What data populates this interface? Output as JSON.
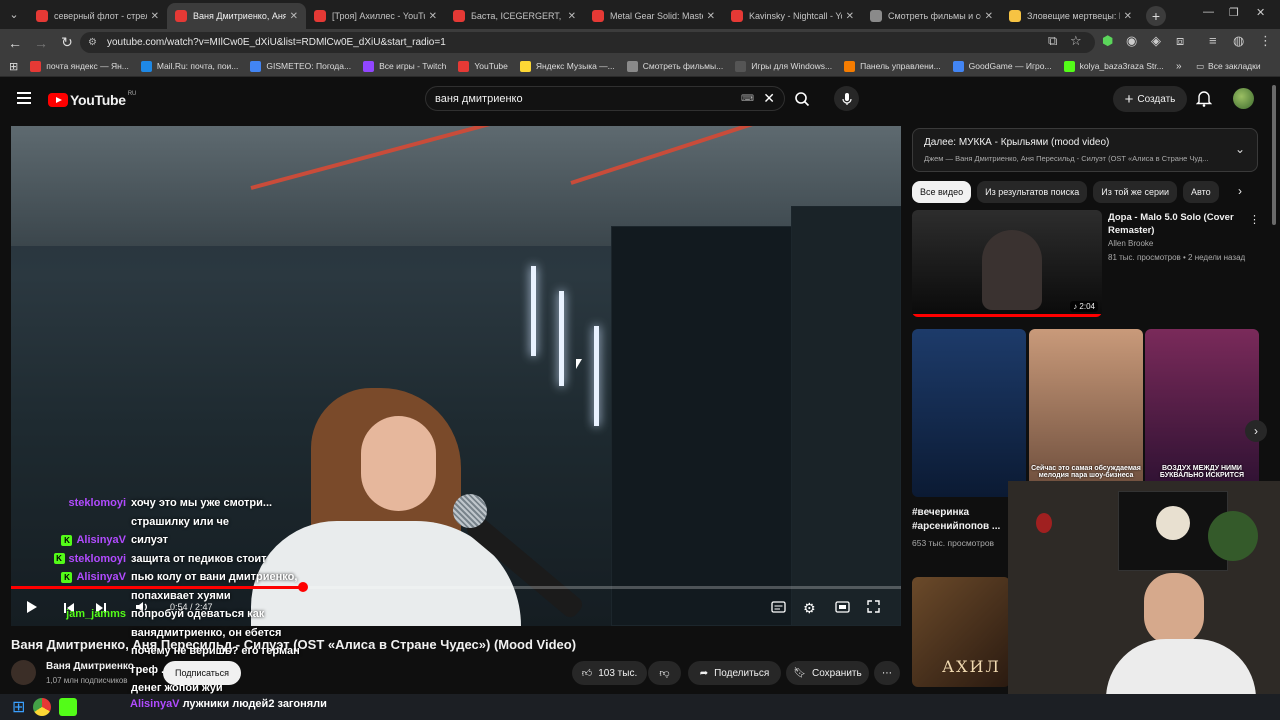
{
  "browser": {
    "tabs": [
      {
        "title": "северный флот - стрельба",
        "color": "#e53935",
        "active": false
      },
      {
        "title": "Ваня Дмитриенко, Аня Пересильд",
        "color": "#e53935",
        "active": true
      },
      {
        "title": "[Троя] Ахиллес - YouTube",
        "color": "#e53935",
        "active": false
      },
      {
        "title": "Баста, ICEGERGERT, MAKS",
        "color": "#e53935",
        "active": false
      },
      {
        "title": "Metal Gear Solid: Master",
        "color": "#e53935",
        "active": false
      },
      {
        "title": "Kavinsky - Nightcall - YouTube",
        "color": "#e53935",
        "active": false
      },
      {
        "title": "Смотреть фильмы и сериалы",
        "color": "#8a8a8a",
        "active": false
      },
      {
        "title": "Зловещие мертвецы: По",
        "color": "#f6c343",
        "active": false
      }
    ],
    "new_tab": "+",
    "url": "youtube.com/watch?v=MIlCw0E_dXiU&list=RDMlCw0E_dXiU&start_radio=1",
    "bookmarks": [
      {
        "label": "почта яндекс — Ян...",
        "color": "#e53935"
      },
      {
        "label": "Mail.Ru: почта, пои...",
        "color": "#1e88e5"
      },
      {
        "label": "GISMETEO: Погода...",
        "color": "#4285f4"
      },
      {
        "label": "Все игры - Twitch",
        "color": "#9146ff"
      },
      {
        "label": "YouTube",
        "color": "#e53935"
      },
      {
        "label": "Яндекс Музыка —...",
        "color": "#fdd835"
      },
      {
        "label": "Смотреть фильмы...",
        "color": "#8a8a8a"
      },
      {
        "label": "Игры для Windows...",
        "color": "#555555"
      },
      {
        "label": "Панель управлени...",
        "color": "#f57c00"
      },
      {
        "label": "GoodGame — Игро...",
        "color": "#4285f4"
      },
      {
        "label": "kolya_baza3raza Str...",
        "color": "#53fc18"
      }
    ],
    "all_bookmarks": "Все закладки"
  },
  "youtube": {
    "logo_text": "YouTube",
    "logo_region": "RU",
    "search_value": "ваня дмитриенко",
    "create_label": "Создать",
    "video": {
      "title": "Ваня Дмитриенко, Аня Пересильд - Силуэт (OST «Алиса в Стране Чудес») (Mood Video)",
      "time_current": "0:54",
      "time_total": "2:47",
      "progress": 0.328
    },
    "channel": {
      "name": "Ваня Дмитриенко",
      "subscribers": "1,07 млн подписчиков",
      "subscribe_label": "Подписаться"
    },
    "actions": {
      "likes": "103 тыс.",
      "share": "Поделиться",
      "save": "Сохранить"
    },
    "up_next": {
      "label": "Далее: МУККА - Крыльями (mood video)",
      "sub": "Джем — Ваня Дмитриенко, Аня Пересильд - Силуэт (OST «Алиса в Стране Чуд..."
    },
    "chips": [
      "Все видео",
      "Из результатов поиска",
      "Из той же серии",
      "Авто"
    ],
    "rec1": {
      "title": "Дора - Malo 5.0 Solo (Cover Remaster)",
      "channel": "Allen Brooke",
      "meta": "81 тыс. просмотров • 2 недели назад",
      "duration": "2:04"
    },
    "shorts": [
      {
        "caption": ""
      },
      {
        "caption": "Сейчас это самая обсуждаемая мелодия пара шоу-бизнеса"
      },
      {
        "caption": "ВОЗДУХ МЕЖДУ НИМИ БУКВАЛЬНО ИСКРИТСЯ"
      }
    ],
    "short_title": "#вечеринка #арсенийпопов ...",
    "short_views": "653 тыс. просмотров",
    "rec2_text": "АХИЛ"
  },
  "chat": [
    {
      "nick": "steklomoyi",
      "color": "#b14bff",
      "badge": false,
      "msg": "хочу это мы уже смотри..."
    },
    {
      "nick": "",
      "color": "#53fc18",
      "badge": false,
      "msg": "страшилку или че"
    },
    {
      "nick": "AlisinyaV",
      "color": "#b14bff",
      "badge": true,
      "msg": "силуэт"
    },
    {
      "nick": "steklomoyi",
      "color": "#b14bff",
      "badge": true,
      "msg": "защита от педиков стоит"
    },
    {
      "nick": "AlisinyaV",
      "color": "#b14bff",
      "badge": true,
      "msg": "пью колу от вани дмитриенко,"
    },
    {
      "nick": "",
      "color": "#53fc18",
      "badge": false,
      "msg": "попахивает хуями"
    },
    {
      "nick": "jam_jamms",
      "color": "#53fc18",
      "badge": false,
      "msg": "попробуй одеваться как"
    },
    {
      "nick": "",
      "color": "#53fc18",
      "badge": false,
      "msg": "ванядмитриенко, он ебется"
    },
    {
      "nick": "",
      "color": "#53fc18",
      "badge": false,
      "msg": "почему не веришь? его герман"
    },
    {
      "nick": "",
      "color": "#53fc18",
      "badge": false,
      "msg": "греф ... нам у него"
    },
    {
      "nick": "",
      "color": "#53fc18",
      "badge": false,
      "msg": "денег жопой жуй"
    }
  ],
  "taskbar_chat": "AlisinyaV",
  "taskbar_msg": "лужники людей2 загоняли"
}
